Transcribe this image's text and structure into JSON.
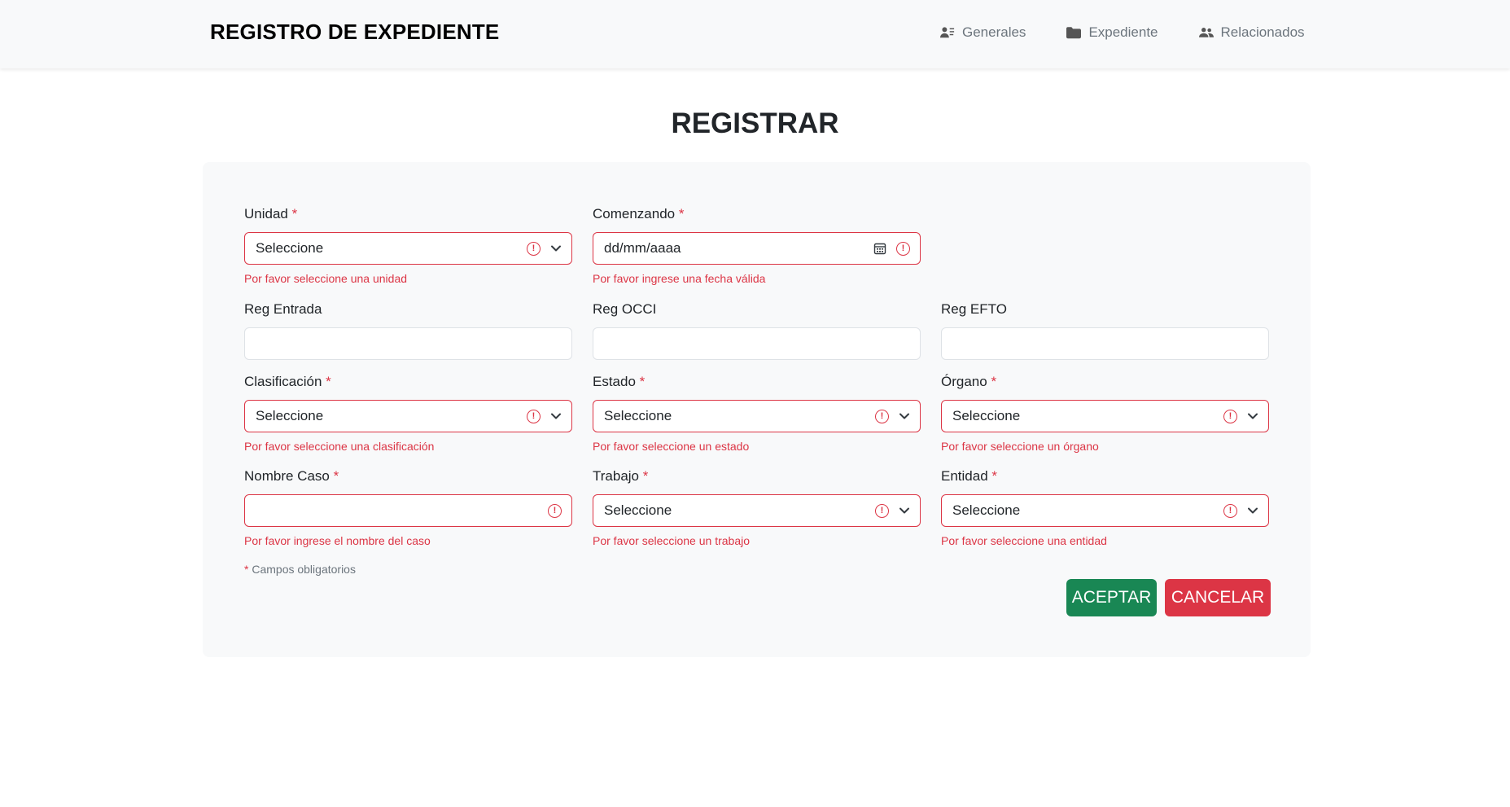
{
  "header": {
    "brand": "REGISTRO DE EXPEDIENTE",
    "nav": [
      {
        "label": "Generales",
        "icon": "user-list-icon"
      },
      {
        "label": "Expediente",
        "icon": "folder-icon"
      },
      {
        "label": "Relacionados",
        "icon": "users-icon"
      }
    ]
  },
  "page_title": "REGISTRAR",
  "form": {
    "unidad": {
      "label": "Unidad",
      "value": "Seleccione",
      "feedback": "Por favor seleccione una unidad"
    },
    "comenzando": {
      "label": "Comenzando",
      "value": "dd/mm/aaaa",
      "feedback": "Por favor ingrese una fecha válida"
    },
    "reg_entrada": {
      "label": "Reg Entrada",
      "value": ""
    },
    "reg_occi": {
      "label": "Reg OCCI",
      "value": ""
    },
    "reg_efto": {
      "label": "Reg EFTO",
      "value": ""
    },
    "clasificacion": {
      "label": "Clasificación",
      "value": "Seleccione",
      "feedback": "Por favor seleccione una clasificación"
    },
    "estado": {
      "label": "Estado",
      "value": "Seleccione",
      "feedback": "Por favor seleccione un estado"
    },
    "organo": {
      "label": "Órgano",
      "value": "Seleccione",
      "feedback": "Por favor seleccione un órgano"
    },
    "nombre_caso": {
      "label": "Nombre Caso",
      "value": "",
      "feedback": "Por favor ingrese el nombre del caso"
    },
    "trabajo": {
      "label": "Trabajo",
      "value": "Seleccione",
      "feedback": "Por favor seleccione un trabajo"
    },
    "entidad": {
      "label": "Entidad",
      "value": "Seleccione",
      "feedback": "Por favor seleccione una entidad"
    },
    "required_star": "*",
    "required_note": "Campos obligatorios",
    "accept_label": "ACEPTAR",
    "cancel_label": "CANCELAR"
  },
  "colors": {
    "error": "#dc3545",
    "accept": "#198754",
    "cancel": "#dc3545",
    "navbar_bg": "#f8f9fa"
  }
}
